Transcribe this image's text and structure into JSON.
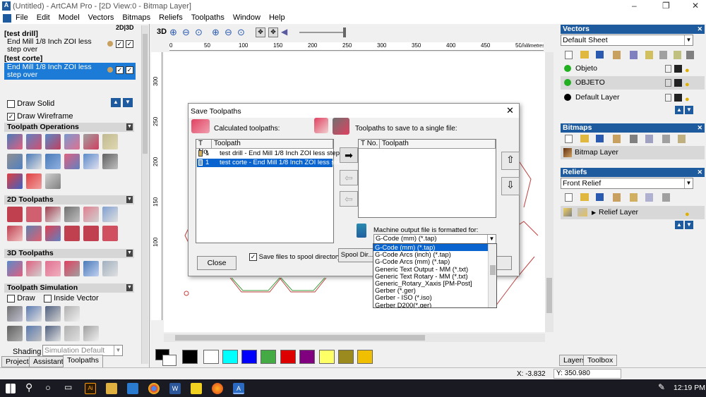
{
  "app": {
    "title": "(Untitled) - ArtCAM Pro - [2D View:0 - Bitmap Layer]",
    "window_controls": [
      "–",
      "❐",
      "✕"
    ]
  },
  "menu": [
    "File",
    "Edit",
    "Model",
    "Vectors",
    "Bitmaps",
    "Reliefs",
    "Toolpaths",
    "Window",
    "Help"
  ],
  "view_toggle": "2D|3D",
  "left": {
    "toolpaths": [
      {
        "name": "[test drill]",
        "tool": "End Mill 1/8 Inch ZOI less step over",
        "selected": false
      },
      {
        "name": "[test corte]",
        "tool": "End Mill 1/8 Inch ZOI less step over",
        "selected": true
      }
    ],
    "draw_solid": "Draw Solid",
    "draw_wireframe": "Draw Wireframe",
    "sections": {
      "ops": "Toolpath Operations",
      "twod": "2D Toolpaths",
      "threed": "3D Toolpaths",
      "sim": "Toolpath Simulation"
    },
    "sim_draw": "Draw",
    "sim_inside": "Inside Vector",
    "shading_label": "Shading",
    "shading_value": "Simulation Default",
    "tabs": [
      "Project",
      "Assistant",
      "Toolpaths"
    ]
  },
  "toolbar": {
    "mode_3d": "3D",
    "units": "millimetres"
  },
  "ruler": {
    "x_ticks": [
      "0",
      "50",
      "100",
      "150",
      "200",
      "250",
      "300",
      "350",
      "400",
      "450",
      "500"
    ],
    "y_ticks": [
      "300",
      "250",
      "200",
      "150",
      "100"
    ]
  },
  "dialog": {
    "title": "Save Toolpaths",
    "close_x": "✕",
    "calc_label": "Calculated toolpaths:",
    "save_label": "Toolpaths to save to a single file:",
    "col_no": "T No.",
    "col_path": "Toolpath",
    "calc_rows": [
      {
        "no": "1",
        "text": "test drill - End Mill 1/8 Inch ZOI less step ...",
        "selected": false
      },
      {
        "no": "1",
        "text": "test corte - End Mill 1/8 Inch ZOI less ste...",
        "selected": true
      }
    ],
    "machine_label": "Machine output file is formatted for:",
    "machine_value": "G-Code (mm) (*.tap)",
    "options": [
      "G-Code (mm) (*.tap)",
      "G-Code Arcs (inch) (*.tap)",
      "G-Code Arcs (mm) (*.tap)",
      "Generic Text Output - MM (*.txt)",
      "Generic Text Rotary - MM (*.txt)",
      "Generic_Rotary_Xaxis [PM-Post]",
      "Gerber (*.ger)",
      "Gerber - ISO (*.iso)",
      "Gerber D200(*.ger)"
    ],
    "close_btn": "Close",
    "spool_label": "Save files to spool directory",
    "spool_btn": "Spool Dir..."
  },
  "right": {
    "vectors_head": "Vectors",
    "sheet": "Default Sheet",
    "layers": [
      {
        "name": "Objeto",
        "color": "#22b022"
      },
      {
        "name": "OBJETO",
        "color": "#22b022"
      },
      {
        "name": "Default Layer",
        "color": "#000000"
      }
    ],
    "bitmaps_head": "Bitmaps",
    "bitmap_layer": "Bitmap Layer",
    "reliefs_head": "Reliefs",
    "relief": "Front Relief",
    "relief_layer": "Relief Layer",
    "tabs": [
      "Layers",
      "Toolbox"
    ]
  },
  "palette": [
    "#000000",
    "#ffffff",
    "#00ffff",
    "#0000ff",
    "#44aa44",
    "#dd0000",
    "#800080",
    "#ffff66",
    "#9b8b1f",
    "#f0c000"
  ],
  "status": {
    "x": "X: -3.832",
    "y": "Y: 350.980"
  },
  "clock": "12:19 PM"
}
